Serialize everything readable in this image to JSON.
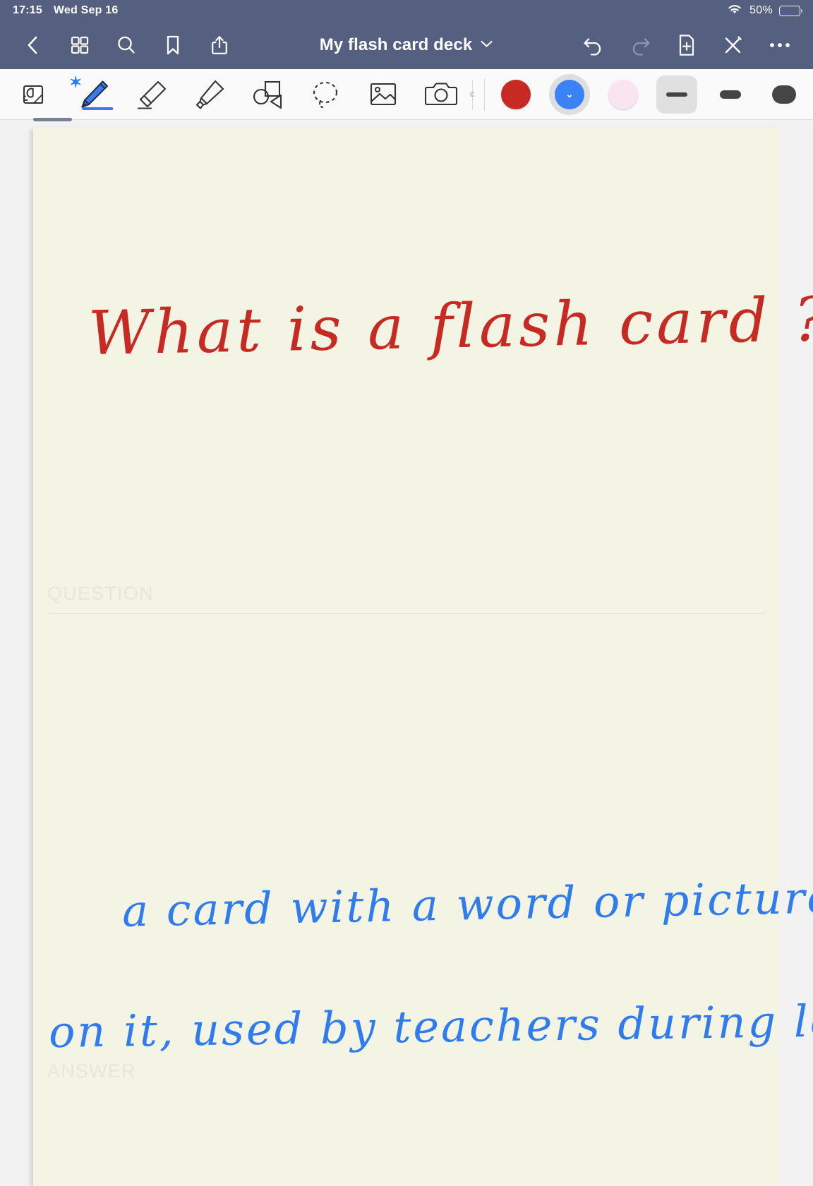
{
  "status_bar": {
    "time": "17:15",
    "date": "Wed Sep 16",
    "wifi_icon": "wifi-icon",
    "battery_percent": "50%",
    "battery_level": 50
  },
  "nav_bar": {
    "back_icon": "chevron-left-icon",
    "grid_icon": "grid-view-icon",
    "search_icon": "search-icon",
    "bookmark_icon": "bookmark-icon",
    "share_icon": "share-icon",
    "title": "My flash card deck",
    "title_chevron_icon": "chevron-down-icon",
    "undo_icon": "undo-icon",
    "redo_icon": "redo-icon",
    "add_page_icon": "add-page-icon",
    "close_pen_icon": "close-pen-icon",
    "more_icon": "more-options-icon",
    "background_color": "#555F80"
  },
  "toolbar": {
    "tools": [
      {
        "name": "palm-rejection-icon",
        "label": "Palm rejection",
        "active": false
      },
      {
        "name": "pen-icon",
        "label": "Pen",
        "active": true,
        "bluetooth_badge": "bluetooth-icon"
      },
      {
        "name": "eraser-icon",
        "label": "Eraser",
        "active": false
      },
      {
        "name": "highlighter-icon",
        "label": "Highlighter",
        "active": false
      },
      {
        "name": "shapes-icon",
        "label": "Shapes",
        "active": false
      },
      {
        "name": "lasso-select-icon",
        "label": "Lasso select",
        "active": false
      },
      {
        "name": "image-icon",
        "label": "Insert image",
        "active": false
      },
      {
        "name": "camera-icon",
        "label": "Camera",
        "active": false
      }
    ],
    "colors": [
      {
        "name": "color-swatch-red",
        "hex": "#C62A22",
        "selected": false
      },
      {
        "name": "color-swatch-blue",
        "hex": "#3B82F6",
        "selected": true
      },
      {
        "name": "color-swatch-pink",
        "hex": "#F9E4F0",
        "selected": false
      }
    ],
    "stroke_widths": [
      {
        "name": "stroke-width-thin",
        "selected": true
      },
      {
        "name": "stroke-width-medium",
        "selected": false
      },
      {
        "name": "stroke-width-thick",
        "selected": false
      }
    ]
  },
  "card": {
    "background_color": "#F4F4E4",
    "question": {
      "label": "QUESTION",
      "ink_text": "What is a flash card ?",
      "ink_color": "#C62A22"
    },
    "answer": {
      "label": "ANSWER",
      "ink_line_1": "a card with a word or picture",
      "ink_line_2": "on it, used by teachers during lessons",
      "ink_color": "#2F7CEE"
    }
  }
}
